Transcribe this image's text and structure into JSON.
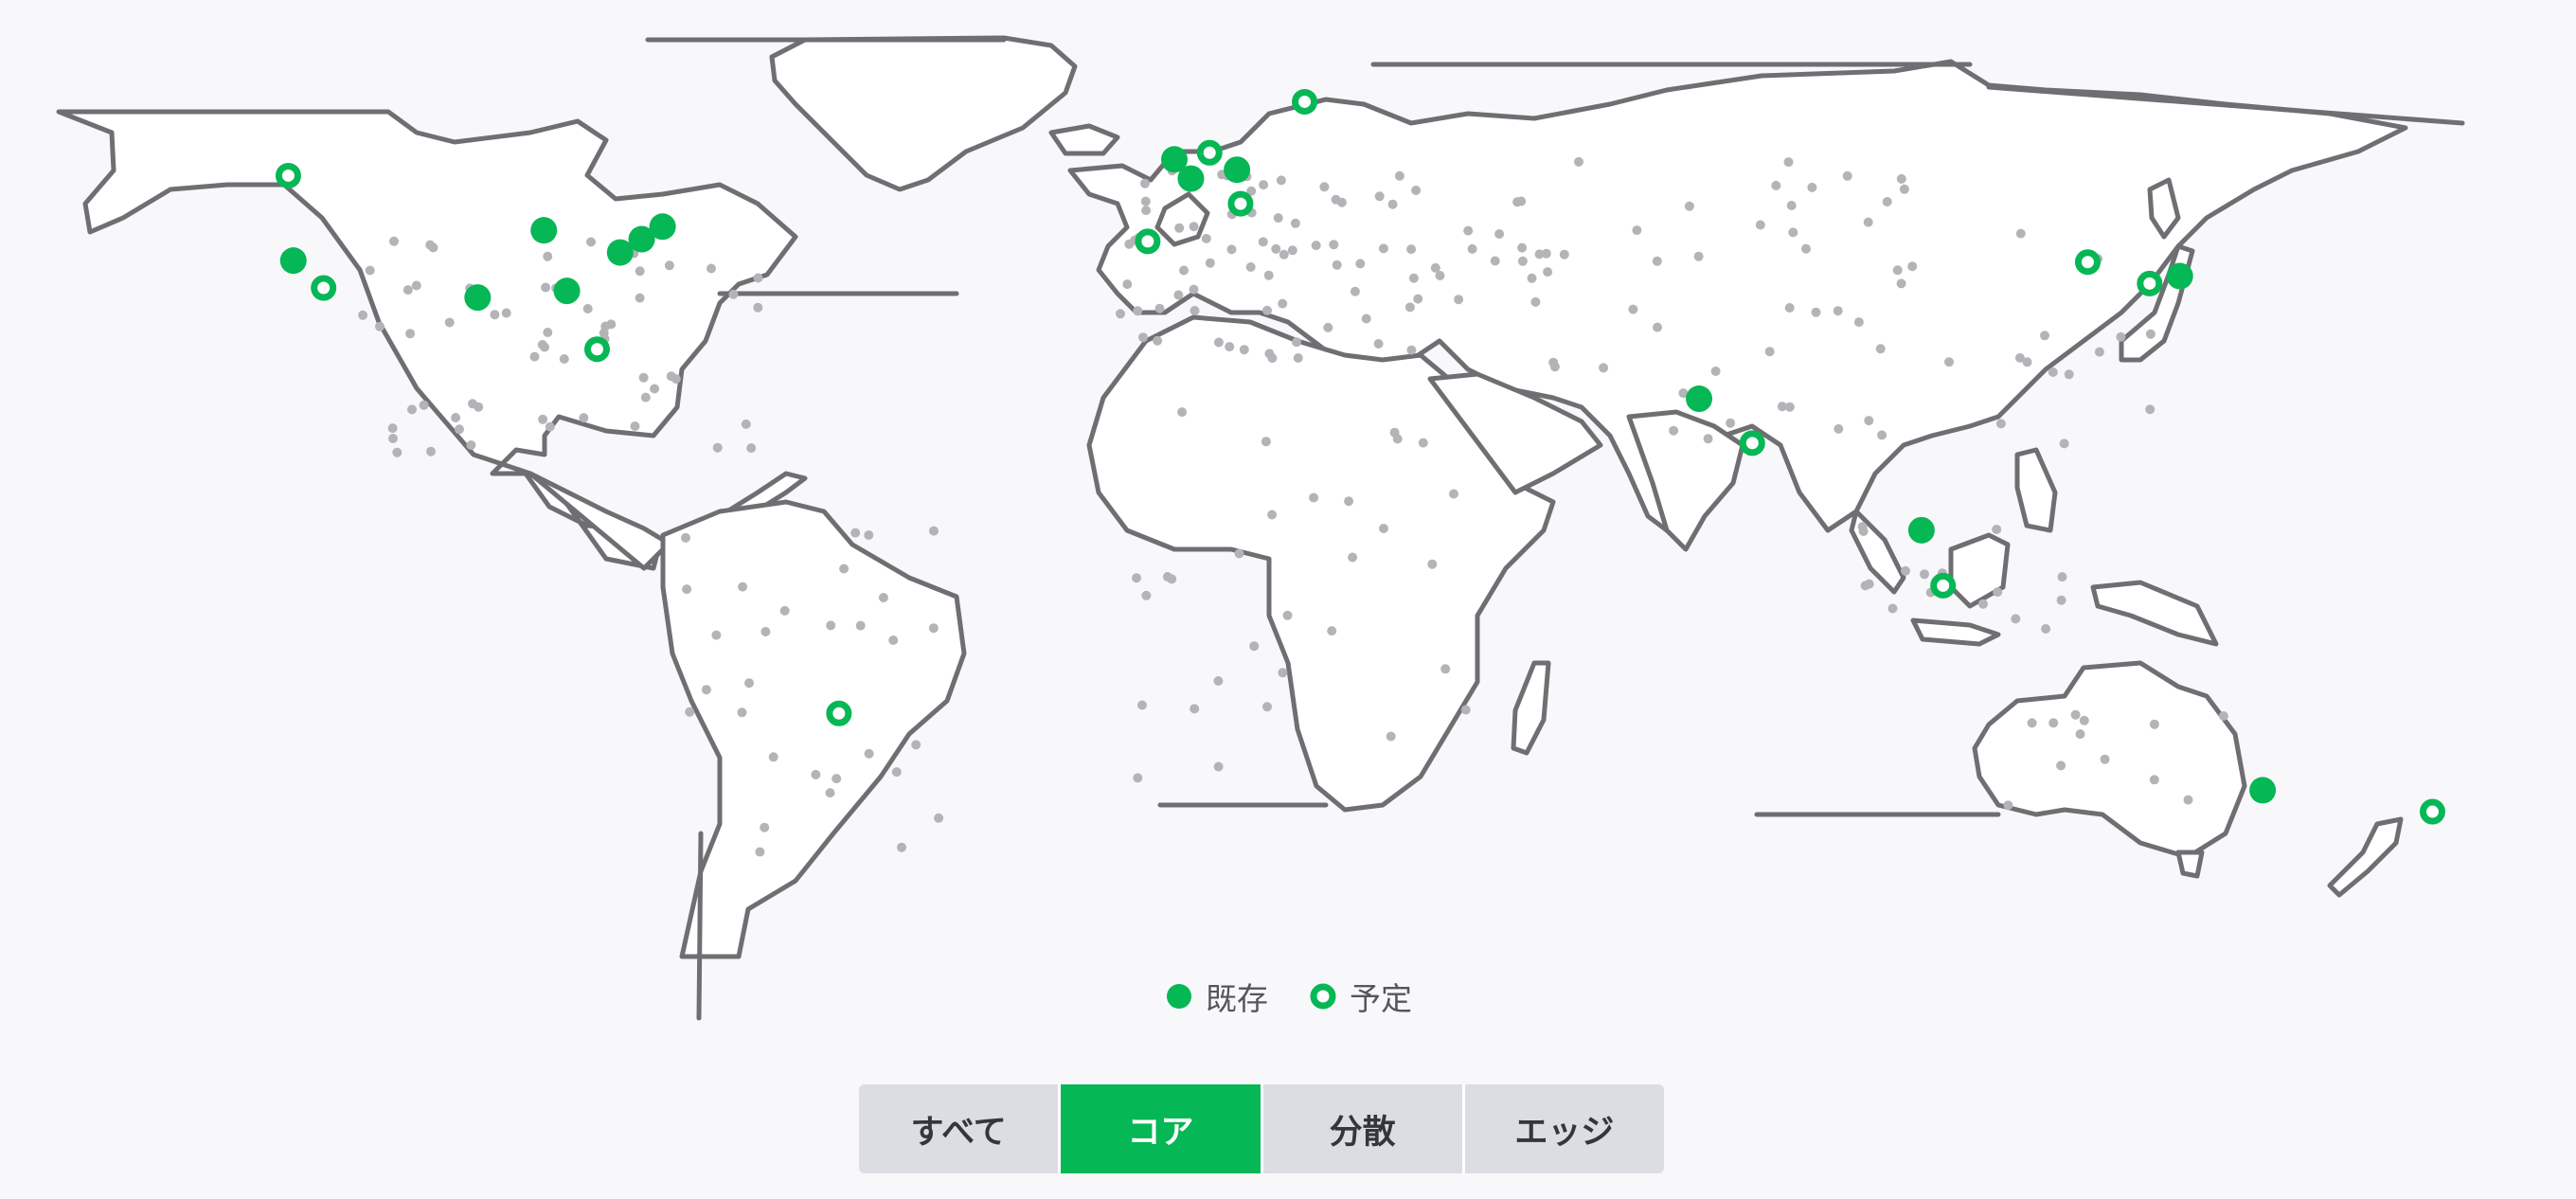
{
  "colors": {
    "accent": "#06b755",
    "outline": "#6f6f73",
    "minor_dot": "#b4b4b8",
    "tab_inactive": "#dcdde2",
    "background": "#f8f8fa"
  },
  "legend": {
    "existing_label": "既存",
    "planned_label": "予定"
  },
  "tabs": [
    {
      "label": "すべて",
      "active": false
    },
    {
      "label": "コア",
      "active": true
    },
    {
      "label": "分散",
      "active": false
    },
    {
      "label": "エッジ",
      "active": false
    }
  ],
  "locations": {
    "existing": [
      [
        -122.4,
        37.8
      ],
      [
        -87.6,
        41.9
      ],
      [
        -96.8,
        32.8
      ],
      [
        -84.4,
        33.7
      ],
      [
        -77.0,
        38.9
      ],
      [
        -74.0,
        40.7
      ],
      [
        -71.1,
        42.4
      ],
      [
        0.0,
        51.5
      ],
      [
        2.3,
        48.9
      ],
      [
        8.7,
        50.1
      ],
      [
        72.9,
        19.1
      ],
      [
        103.8,
        1.3
      ],
      [
        139.7,
        35.7
      ],
      [
        151.2,
        -33.9
      ]
    ],
    "planned": [
      [
        -123.1,
        49.3
      ],
      [
        -118.2,
        34.1
      ],
      [
        -80.2,
        25.8
      ],
      [
        -46.6,
        -23.5
      ],
      [
        4.9,
        52.4
      ],
      [
        18.1,
        59.3
      ],
      [
        9.2,
        45.5
      ],
      [
        -3.7,
        40.4
      ],
      [
        80.3,
        13.1
      ],
      [
        106.8,
        -6.2
      ],
      [
        126.9,
        37.6
      ],
      [
        135.5,
        34.7
      ],
      [
        174.8,
        -36.8
      ]
    ]
  }
}
